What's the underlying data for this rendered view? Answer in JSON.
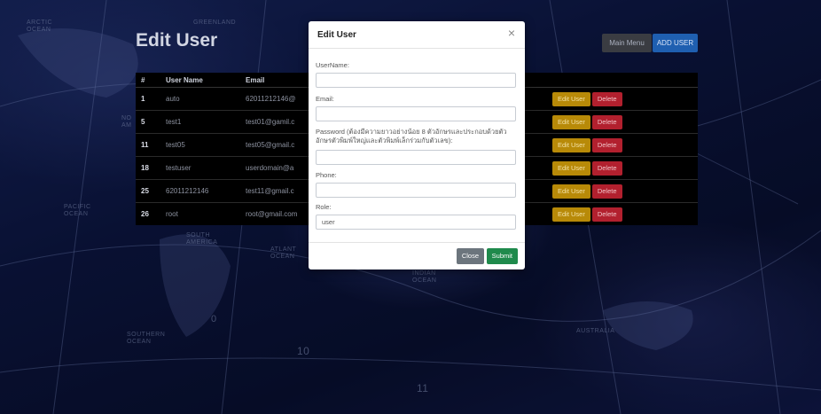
{
  "map_labels": {
    "arctic": "ARCTIC\nOCEAN",
    "greenland": "GREENLAND",
    "north_am": "NO\nAM",
    "pacific": "PACIFIC\nOCEAN",
    "south_america": "SOUTH\nAMERICA",
    "atlantic": "ATLANT\nOCEAN",
    "indian": "INDIAN\nOCEAN",
    "southern": "SOUTHERN\nOCEAN",
    "australia": "AUSTRALIA",
    "num_0": "0",
    "num_10": "10",
    "num_11": "11"
  },
  "page": {
    "title": "Edit User",
    "main_menu_label": "Main Menu",
    "add_user_label": "ADD USER"
  },
  "table": {
    "headers": [
      "#",
      "User Name",
      "Email"
    ],
    "rows": [
      {
        "id": "1",
        "username": "auto",
        "email": "62011212146@",
        "edit": "Edit User",
        "delete": "Delete"
      },
      {
        "id": "5",
        "username": "test1",
        "email": "test01@gamil.c",
        "edit": "Edit User",
        "delete": "Delete"
      },
      {
        "id": "11",
        "username": "test05",
        "email": "test05@gmail.c",
        "edit": "Edit User",
        "delete": "Delete"
      },
      {
        "id": "18",
        "username": "testuser",
        "email": "userdomain@a",
        "edit": "Edit User",
        "delete": "Delete"
      },
      {
        "id": "25",
        "username": "62011212146",
        "email": "test11@gmail.c",
        "edit": "Edit User",
        "delete": "Delete"
      },
      {
        "id": "26",
        "username": "root",
        "email": "root@gmail.com",
        "edit": "Edit User",
        "delete": "Delete"
      }
    ]
  },
  "modal": {
    "title": "Edit User",
    "close_icon": "×",
    "username_label": "UserName:",
    "username_value": "",
    "email_label": "Email:",
    "email_value": "",
    "password_label": "Password (ต้องมีความยาวอย่างน้อย 8 ตัวอักษรและประกอบด้วยตัวอักษรตัวพิมพ์ใหญ่และตัวพิมพ์เล็กร่วมกับตัวเลข):",
    "password_value": "",
    "phone_label": "Phone:",
    "phone_value": "",
    "role_label": "Role:",
    "role_value": "user",
    "close_button": "Close",
    "submit_button": "Submit"
  }
}
